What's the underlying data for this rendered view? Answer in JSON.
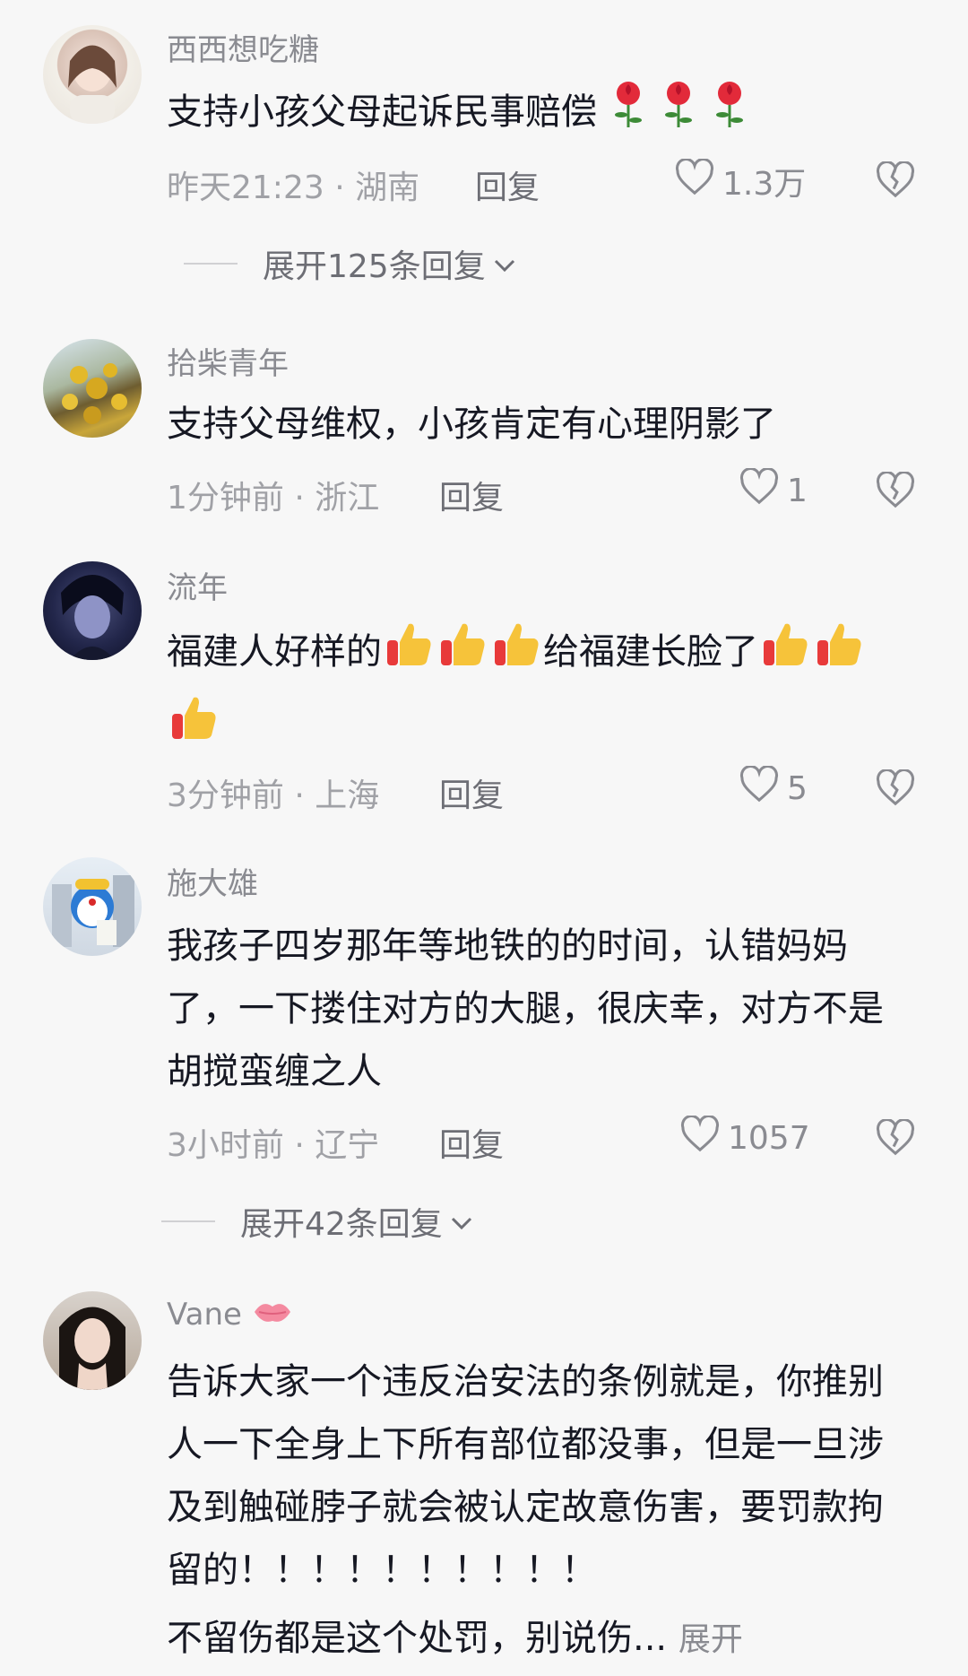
{
  "comments": [
    {
      "username": "西西想吃糖",
      "text": "支持小孩父母起诉民事赔偿",
      "emojis": [
        "rose",
        "rose",
        "rose"
      ],
      "time": "昨天21:23",
      "location": "湖南",
      "reply_label": "回复",
      "likes": "1.3万",
      "expand_label": "展开125条回复"
    },
    {
      "username": "拾柴青年",
      "text": "支持父母维权，小孩肯定有心理阴影了",
      "time": "1分钟前",
      "location": "浙江",
      "reply_label": "回复",
      "likes": "1"
    },
    {
      "username": "流年",
      "text_part1": "福建人好样的",
      "text_part2": "给福建长脸了",
      "time": "3分钟前",
      "location": "上海",
      "reply_label": "回复",
      "likes": "5"
    },
    {
      "username": "施大雄",
      "text": "我孩子四岁那年等地铁的的时间，认错妈妈了，一下搂住对方的大腿，很庆幸，对方不是胡搅蛮缠之人",
      "time": "3小时前",
      "location": "辽宁",
      "reply_label": "回复",
      "likes": "1057",
      "expand_label": "展开42条回复"
    },
    {
      "username": "Vane",
      "text": "告诉大家一个违反治安法的条例就是，你推别人一下全身上下所有部位都没事，但是一旦涉及到触碰脖子就会被认定故意伤害，要罚款拘留的！！！！！！！！！！",
      "text_tail": "不留伤都是这个处罚，别说伤...",
      "more_label": "展开"
    }
  ],
  "separator": "·",
  "icons": {
    "like": "heart-outline-icon",
    "dislike": "broken-heart-icon",
    "expand": "chevron-down-icon"
  }
}
